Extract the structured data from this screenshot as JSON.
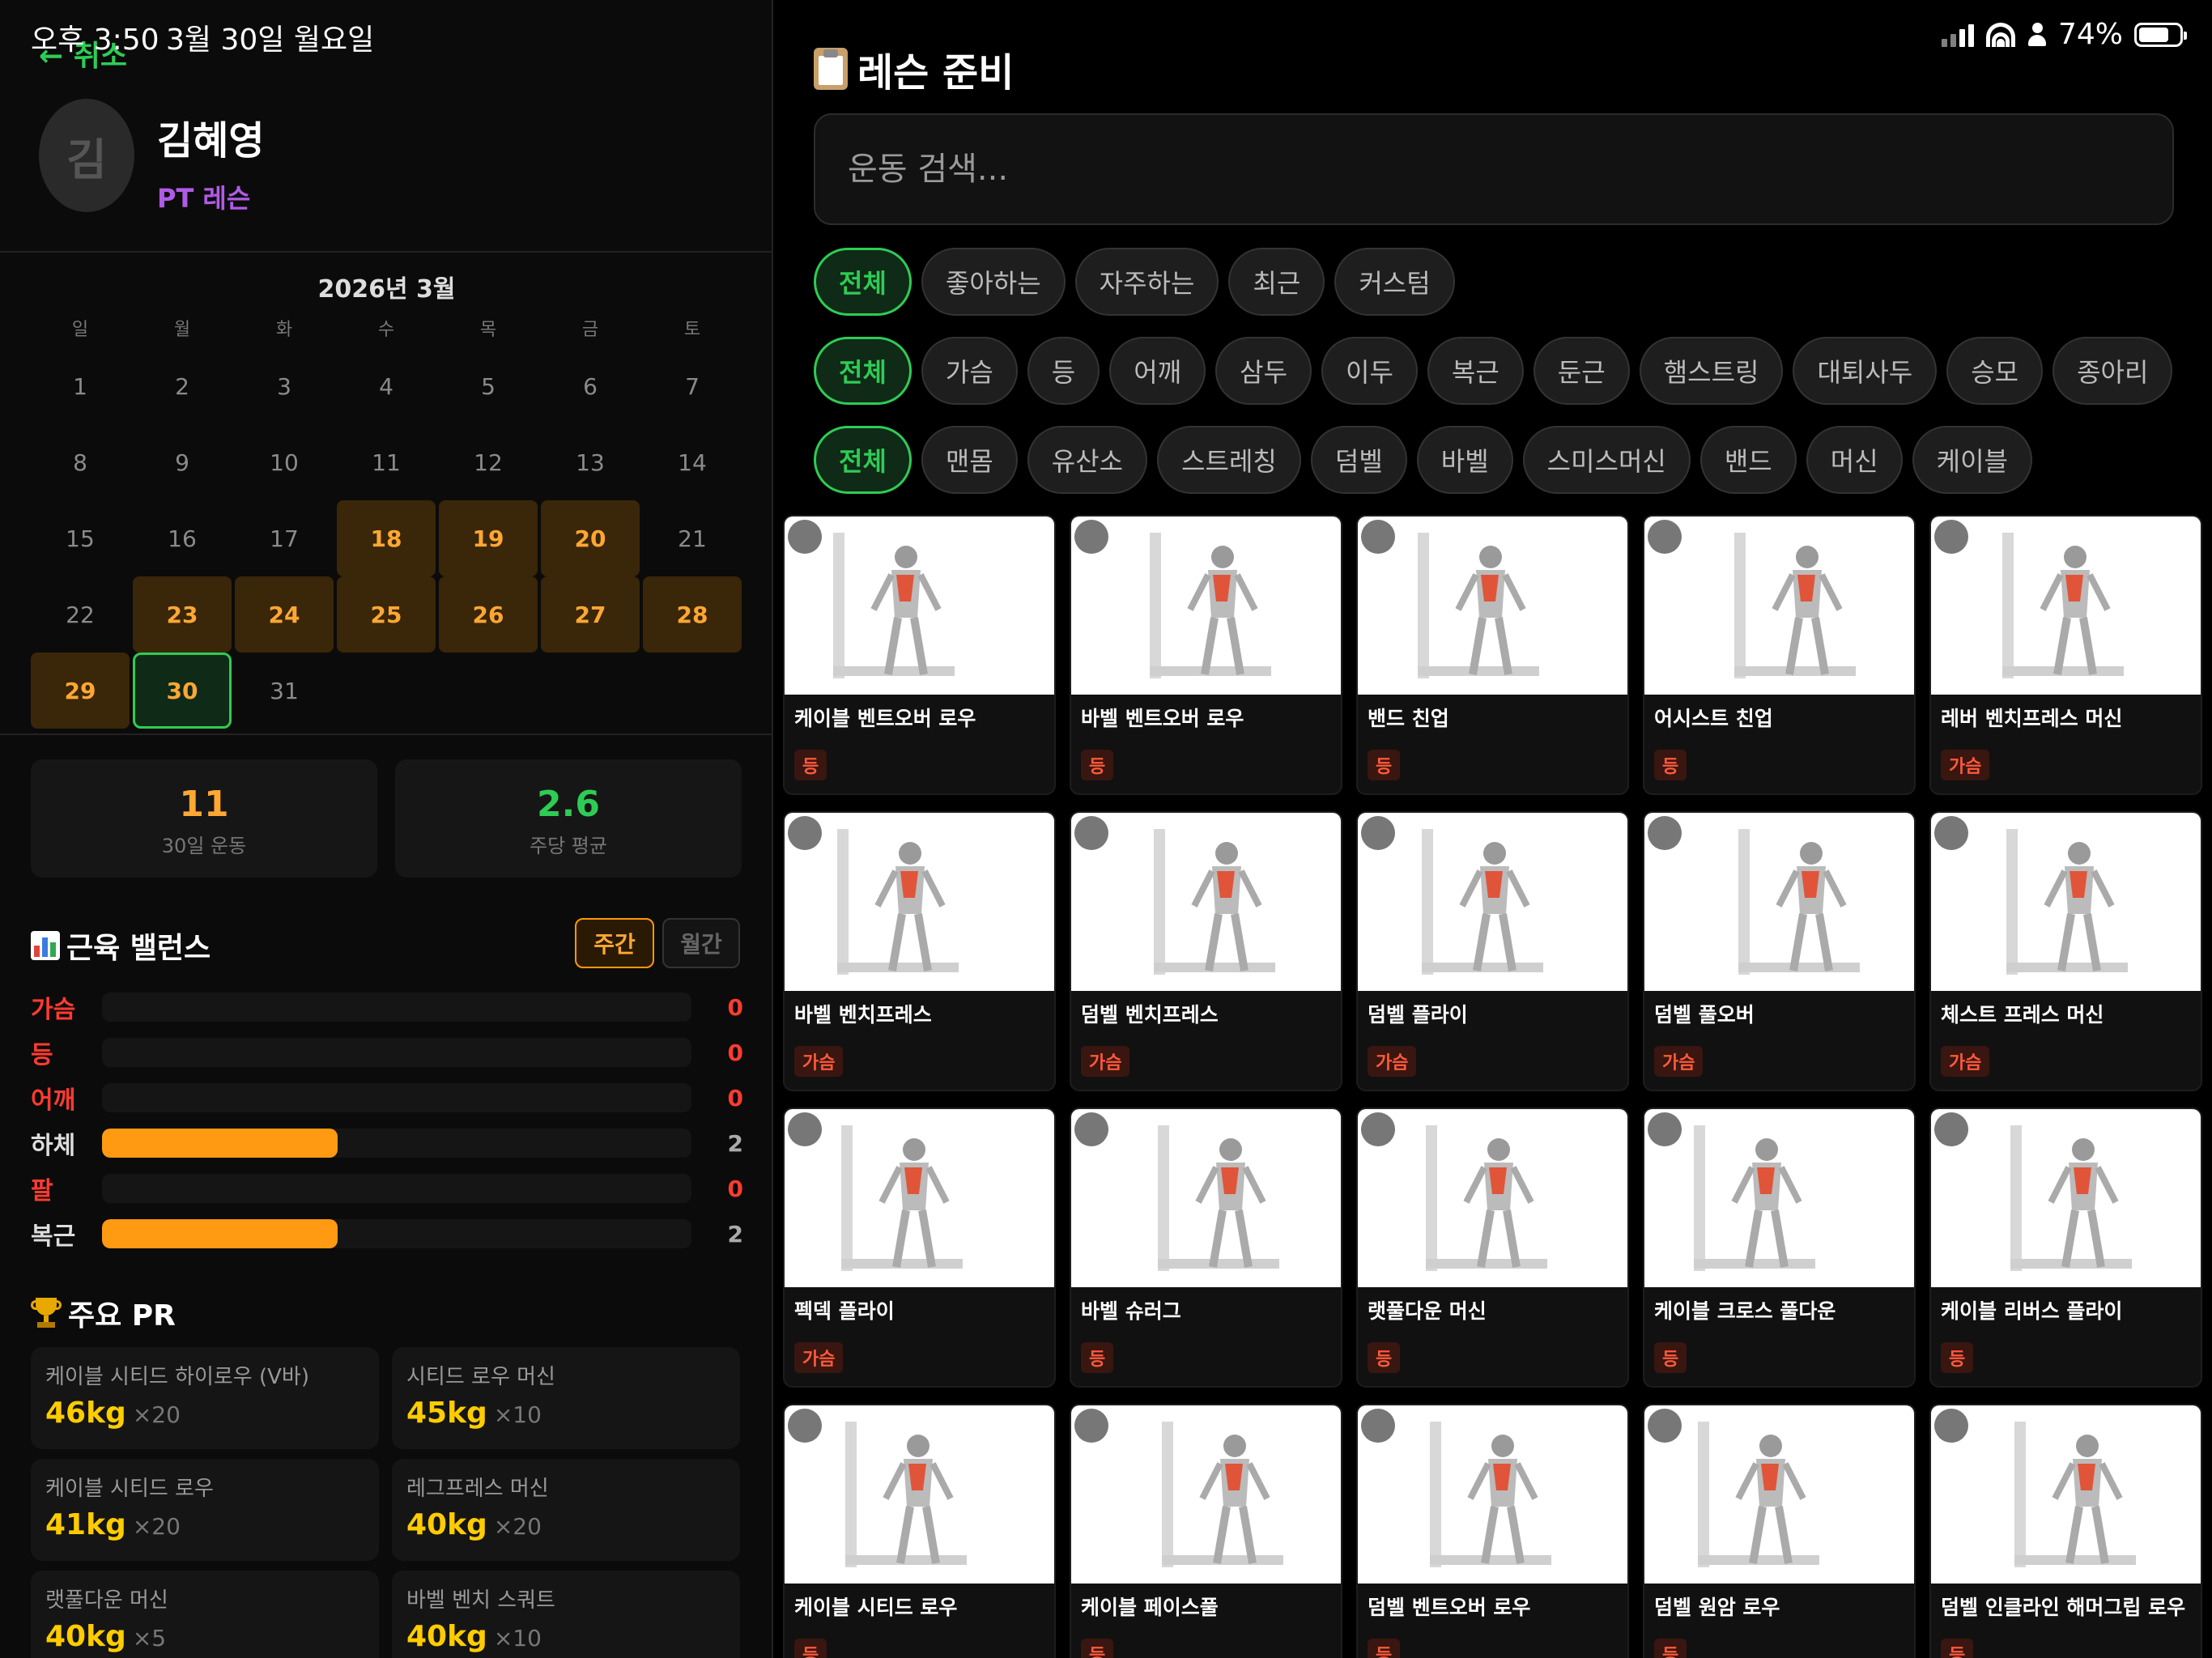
{
  "status_bar": {
    "time": "오후 3:50",
    "date": "3월 30일 월요일",
    "battery": "74%"
  },
  "left": {
    "cancel_label": "← 취소",
    "avatar_initial": "김",
    "client_name": "김혜영",
    "client_type": "PT 레슨",
    "calendar": {
      "title": "2026년 3월",
      "weekdays": [
        "일",
        "월",
        "화",
        "수",
        "목",
        "금",
        "토"
      ],
      "days": [
        "1",
        "2",
        "3",
        "4",
        "5",
        "6",
        "7",
        "8",
        "9",
        "10",
        "11",
        "12",
        "13",
        "14",
        "15",
        "16",
        "17",
        "18",
        "19",
        "20",
        "21",
        "22",
        "23",
        "24",
        "25",
        "26",
        "27",
        "28",
        "29",
        "30",
        "31"
      ],
      "active_days": [
        18,
        19,
        20,
        23,
        24,
        25,
        26,
        27,
        28,
        29
      ],
      "today": 30
    },
    "stats": [
      {
        "value": "11",
        "label": "30일 운동",
        "color": "#ffa733"
      },
      {
        "value": "2.6",
        "label": "주당 평균",
        "color": "#2ecc55"
      }
    ],
    "balance": {
      "title": "근육 밸런스",
      "toggle_weekly": "주간",
      "toggle_monthly": "월간",
      "rows": [
        {
          "label": "가슴",
          "value": "0",
          "fraction": 0,
          "color": "#ff3b30"
        },
        {
          "label": "등",
          "value": "0",
          "fraction": 0,
          "color": "#ff3b30"
        },
        {
          "label": "어깨",
          "value": "0",
          "fraction": 0,
          "color": "#ff3b30"
        },
        {
          "label": "하체",
          "value": "2",
          "fraction": 0.4,
          "color": "#dddddd"
        },
        {
          "label": "팔",
          "value": "0",
          "fraction": 0,
          "color": "#ff3b30"
        },
        {
          "label": "복근",
          "value": "2",
          "fraction": 0.4,
          "color": "#dddddd"
        }
      ]
    },
    "pr": {
      "title": "주요 PR",
      "items": [
        {
          "name": "케이블 시티드 하이로우 (V바)",
          "weight": "46kg",
          "reps": "×20"
        },
        {
          "name": "시티드 로우 머신",
          "weight": "45kg",
          "reps": "×10"
        },
        {
          "name": "케이블 시티드 로우",
          "weight": "41kg",
          "reps": "×20"
        },
        {
          "name": "레그프레스 머신",
          "weight": "40kg",
          "reps": "×20"
        },
        {
          "name": "랫풀다운 머신",
          "weight": "40kg",
          "reps": "×5"
        },
        {
          "name": "바벨 벤치 스쿼트",
          "weight": "40kg",
          "reps": "×10"
        }
      ]
    }
  },
  "right": {
    "title": "레슨 준비",
    "search_placeholder": "운동 검색...",
    "filter_rows": [
      [
        "전체",
        "좋아하는",
        "자주하는",
        "최근",
        "커스텀"
      ],
      [
        "전체",
        "가슴",
        "등",
        "어깨",
        "삼두",
        "이두",
        "복근",
        "둔근",
        "햄스트링",
        "대퇴사두",
        "승모",
        "종아리"
      ],
      [
        "전체",
        "맨몸",
        "유산소",
        "스트레칭",
        "덤벨",
        "바벨",
        "스미스머신",
        "밴드",
        "머신",
        "케이블"
      ]
    ],
    "exercises": [
      {
        "name": "케이블 벤트오버 로우",
        "tag": "등"
      },
      {
        "name": "바벨 벤트오버 로우",
        "tag": "등"
      },
      {
        "name": "밴드 친업",
        "tag": "등"
      },
      {
        "name": "어시스트 친업",
        "tag": "등"
      },
      {
        "name": "레버 벤치프레스 머신",
        "tag": "가슴"
      },
      {
        "name": "바벨 벤치프레스",
        "tag": "가슴"
      },
      {
        "name": "덤벨 벤치프레스",
        "tag": "가슴"
      },
      {
        "name": "덤벨 플라이",
        "tag": "가슴"
      },
      {
        "name": "덤벨 풀오버",
        "tag": "가슴"
      },
      {
        "name": "체스트 프레스 머신",
        "tag": "가슴"
      },
      {
        "name": "펙덱 플라이",
        "tag": "가슴"
      },
      {
        "name": "바벨 슈러그",
        "tag": "등"
      },
      {
        "name": "랫풀다운 머신",
        "tag": "등"
      },
      {
        "name": "케이블 크로스 풀다운",
        "tag": "등"
      },
      {
        "name": "케이블 리버스 플라이",
        "tag": "등"
      },
      {
        "name": "케이블 시티드 로우",
        "tag": "등"
      },
      {
        "name": "케이블 페이스풀",
        "tag": "등"
      },
      {
        "name": "덤벨 벤트오버 로우",
        "tag": "등"
      },
      {
        "name": "덤벨 원암 로우",
        "tag": "등"
      },
      {
        "name": "덤벨 인클라인 해머그립 로우",
        "tag": "등"
      }
    ]
  }
}
